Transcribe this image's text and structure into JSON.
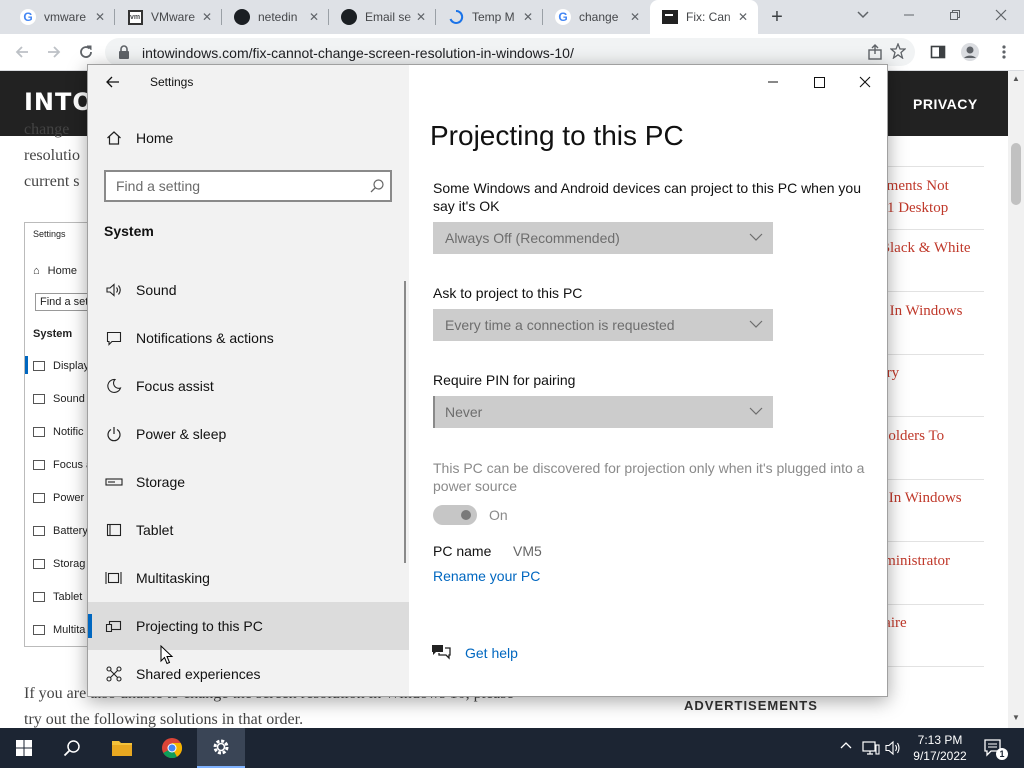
{
  "browser": {
    "tabs": [
      {
        "title": "vmware",
        "icon": "google-icon"
      },
      {
        "title": "VMware",
        "icon": "vmware-icon"
      },
      {
        "title": "netedin",
        "icon": "github-icon"
      },
      {
        "title": "Email se",
        "icon": "github-icon"
      },
      {
        "title": "Temp M",
        "icon": "loading-icon"
      },
      {
        "title": "change",
        "icon": "google-icon"
      },
      {
        "title": "Fix: Can",
        "icon": "site-icon",
        "active": true
      }
    ],
    "url": "intowindows.com/fix-cannot-change-screen-resolution-in-windows-10/"
  },
  "website": {
    "logo": "INTO W",
    "nav_item": "PRIVACY",
    "article_lines_top": [
      "change",
      "resolutio",
      "current s"
    ],
    "screenshot_preview": {
      "title": "Settings",
      "home": "Home",
      "search": "Find a setti",
      "section": "System",
      "items": [
        "Display",
        "Sound",
        "Notific",
        "Focus a",
        "Power",
        "Battery",
        "Storag",
        "Tablet",
        "Multita"
      ]
    },
    "article_lines_bottom": [
      "If you are also unable to change the screen resolution in Windows 10, please",
      "try out the following solutions in that order."
    ],
    "sidebar_links": [
      [
        "ements Not",
        "11 Desktop"
      ],
      [
        "Black & White"
      ],
      [
        "s In Windows"
      ],
      [
        "ery"
      ],
      [
        "Folders To"
      ],
      [
        "r In Windows"
      ],
      [
        "lministrator"
      ],
      [
        "taire"
      ]
    ],
    "ads_label": "ADVERTISEMENTS"
  },
  "settings": {
    "window_title": "Settings",
    "home_label": "Home",
    "search_placeholder": "Find a setting",
    "section_label": "System",
    "nav_items": [
      {
        "label": "Sound",
        "icon": "speaker-icon"
      },
      {
        "label": "Notifications & actions",
        "icon": "notification-icon"
      },
      {
        "label": "Focus assist",
        "icon": "moon-icon"
      },
      {
        "label": "Power & sleep",
        "icon": "power-icon"
      },
      {
        "label": "Storage",
        "icon": "storage-icon"
      },
      {
        "label": "Tablet",
        "icon": "tablet-icon"
      },
      {
        "label": "Multitasking",
        "icon": "multitasking-icon"
      },
      {
        "label": "Projecting to this PC",
        "icon": "projecting-icon",
        "selected": true
      },
      {
        "label": "Shared experiences",
        "icon": "shared-icon"
      }
    ],
    "page_title": "Projecting to this PC",
    "desc1": "Some Windows and Android devices can project to this PC when you say it's OK",
    "dropdown1": "Always Off (Recommended)",
    "label2": "Ask to project to this PC",
    "dropdown2": "Every time a connection is requested",
    "label3": "Require PIN for pairing",
    "dropdown3": "Never",
    "power_note": "This PC can be discovered for projection only when it's plugged into a power source",
    "toggle_state": "On",
    "pc_name_label": "PC name",
    "pc_name_value": "VM5",
    "rename_link": "Rename your PC",
    "help_link": "Get help"
  },
  "taskbar": {
    "time": "7:13 PM",
    "date": "9/17/2022",
    "notification_count": "1"
  }
}
